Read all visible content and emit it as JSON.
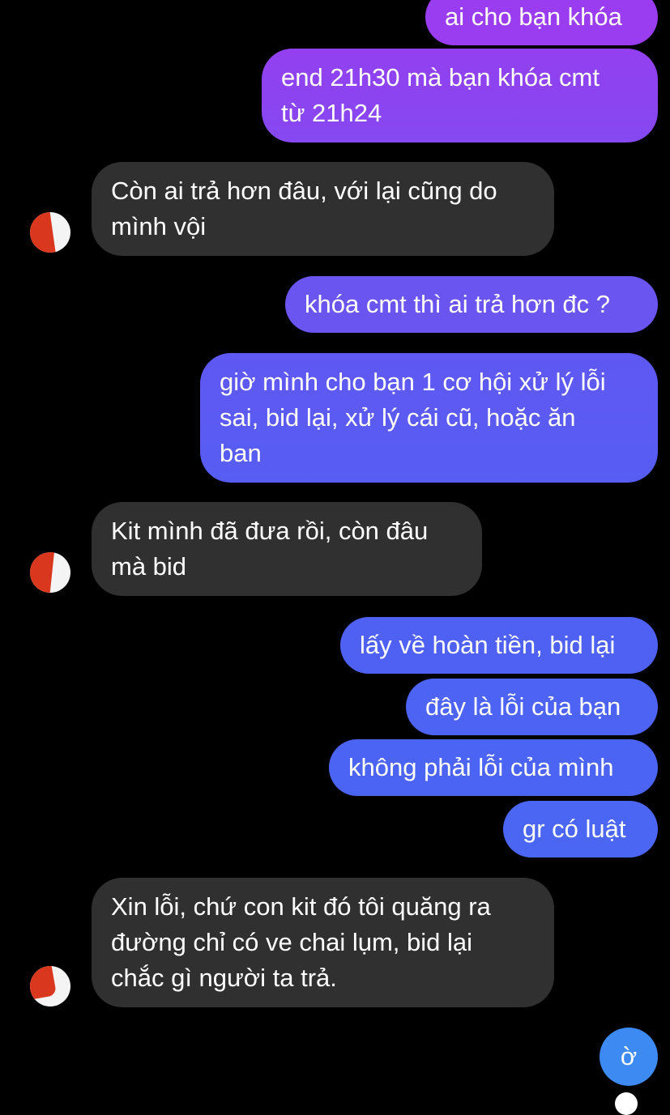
{
  "chat": {
    "messages": [
      {
        "side": "out",
        "text": "ai cho bạn khóa"
      },
      {
        "side": "out",
        "text": "end 21h30 mà bạn khóa cmt\ntừ 21h24"
      },
      {
        "side": "in",
        "text": "Còn ai trả hơn đâu, với lại cũng do\nmình vội"
      },
      {
        "side": "out",
        "text": "khóa cmt thì ai trả hơn đc ?"
      },
      {
        "side": "out",
        "text": "giờ mình cho bạn 1 cơ hội xử lý lỗi\nsai, bid lại, xử lý cái cũ, hoặc ăn\nban"
      },
      {
        "side": "in",
        "text": "Kit mình đã đưa rồi, còn đâu\nmà bid"
      },
      {
        "side": "out",
        "text": "lấy về hoàn tiền, bid lại"
      },
      {
        "side": "out",
        "text": "đây là lỗi của bạn"
      },
      {
        "side": "out",
        "text": "không phải lỗi của mình"
      },
      {
        "side": "out",
        "text": "gr có luật"
      },
      {
        "side": "in",
        "text": "Xin lỗi, chứ con kit đó tôi quăng ra\nđường chỉ có ve chai lụm, bid lại\nchắc gì người ta trả."
      }
    ],
    "last_reply": "ờ"
  },
  "colors": {
    "outgoing_top": "#9b3cf0",
    "outgoing_bottom": "#4a66f2",
    "incoming": "#303030",
    "redaction": "#d9381e"
  },
  "icons": {
    "avatar": "contact-avatar-icon",
    "seen": "seen-avatar-icon"
  }
}
